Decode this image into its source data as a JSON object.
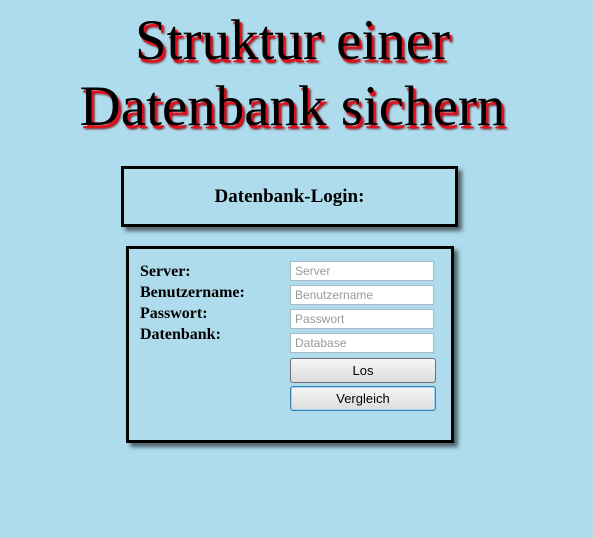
{
  "header": {
    "title_line1": "Struktur einer",
    "title_line2": "Datenbank sichern"
  },
  "login": {
    "heading": "Datenbank-Login:"
  },
  "form": {
    "labels": {
      "server": "Server:",
      "user": "Benutzername:",
      "password": "Passwort:",
      "database": "Datenbank:"
    },
    "placeholders": {
      "server": "Server",
      "user": "Benutzername",
      "password": "Passwort",
      "database": "Database"
    },
    "buttons": {
      "submit": "Los",
      "compare": "Vergleich"
    }
  },
  "colors": {
    "background": "#aedcec",
    "title_shadow": "#e0101c"
  }
}
